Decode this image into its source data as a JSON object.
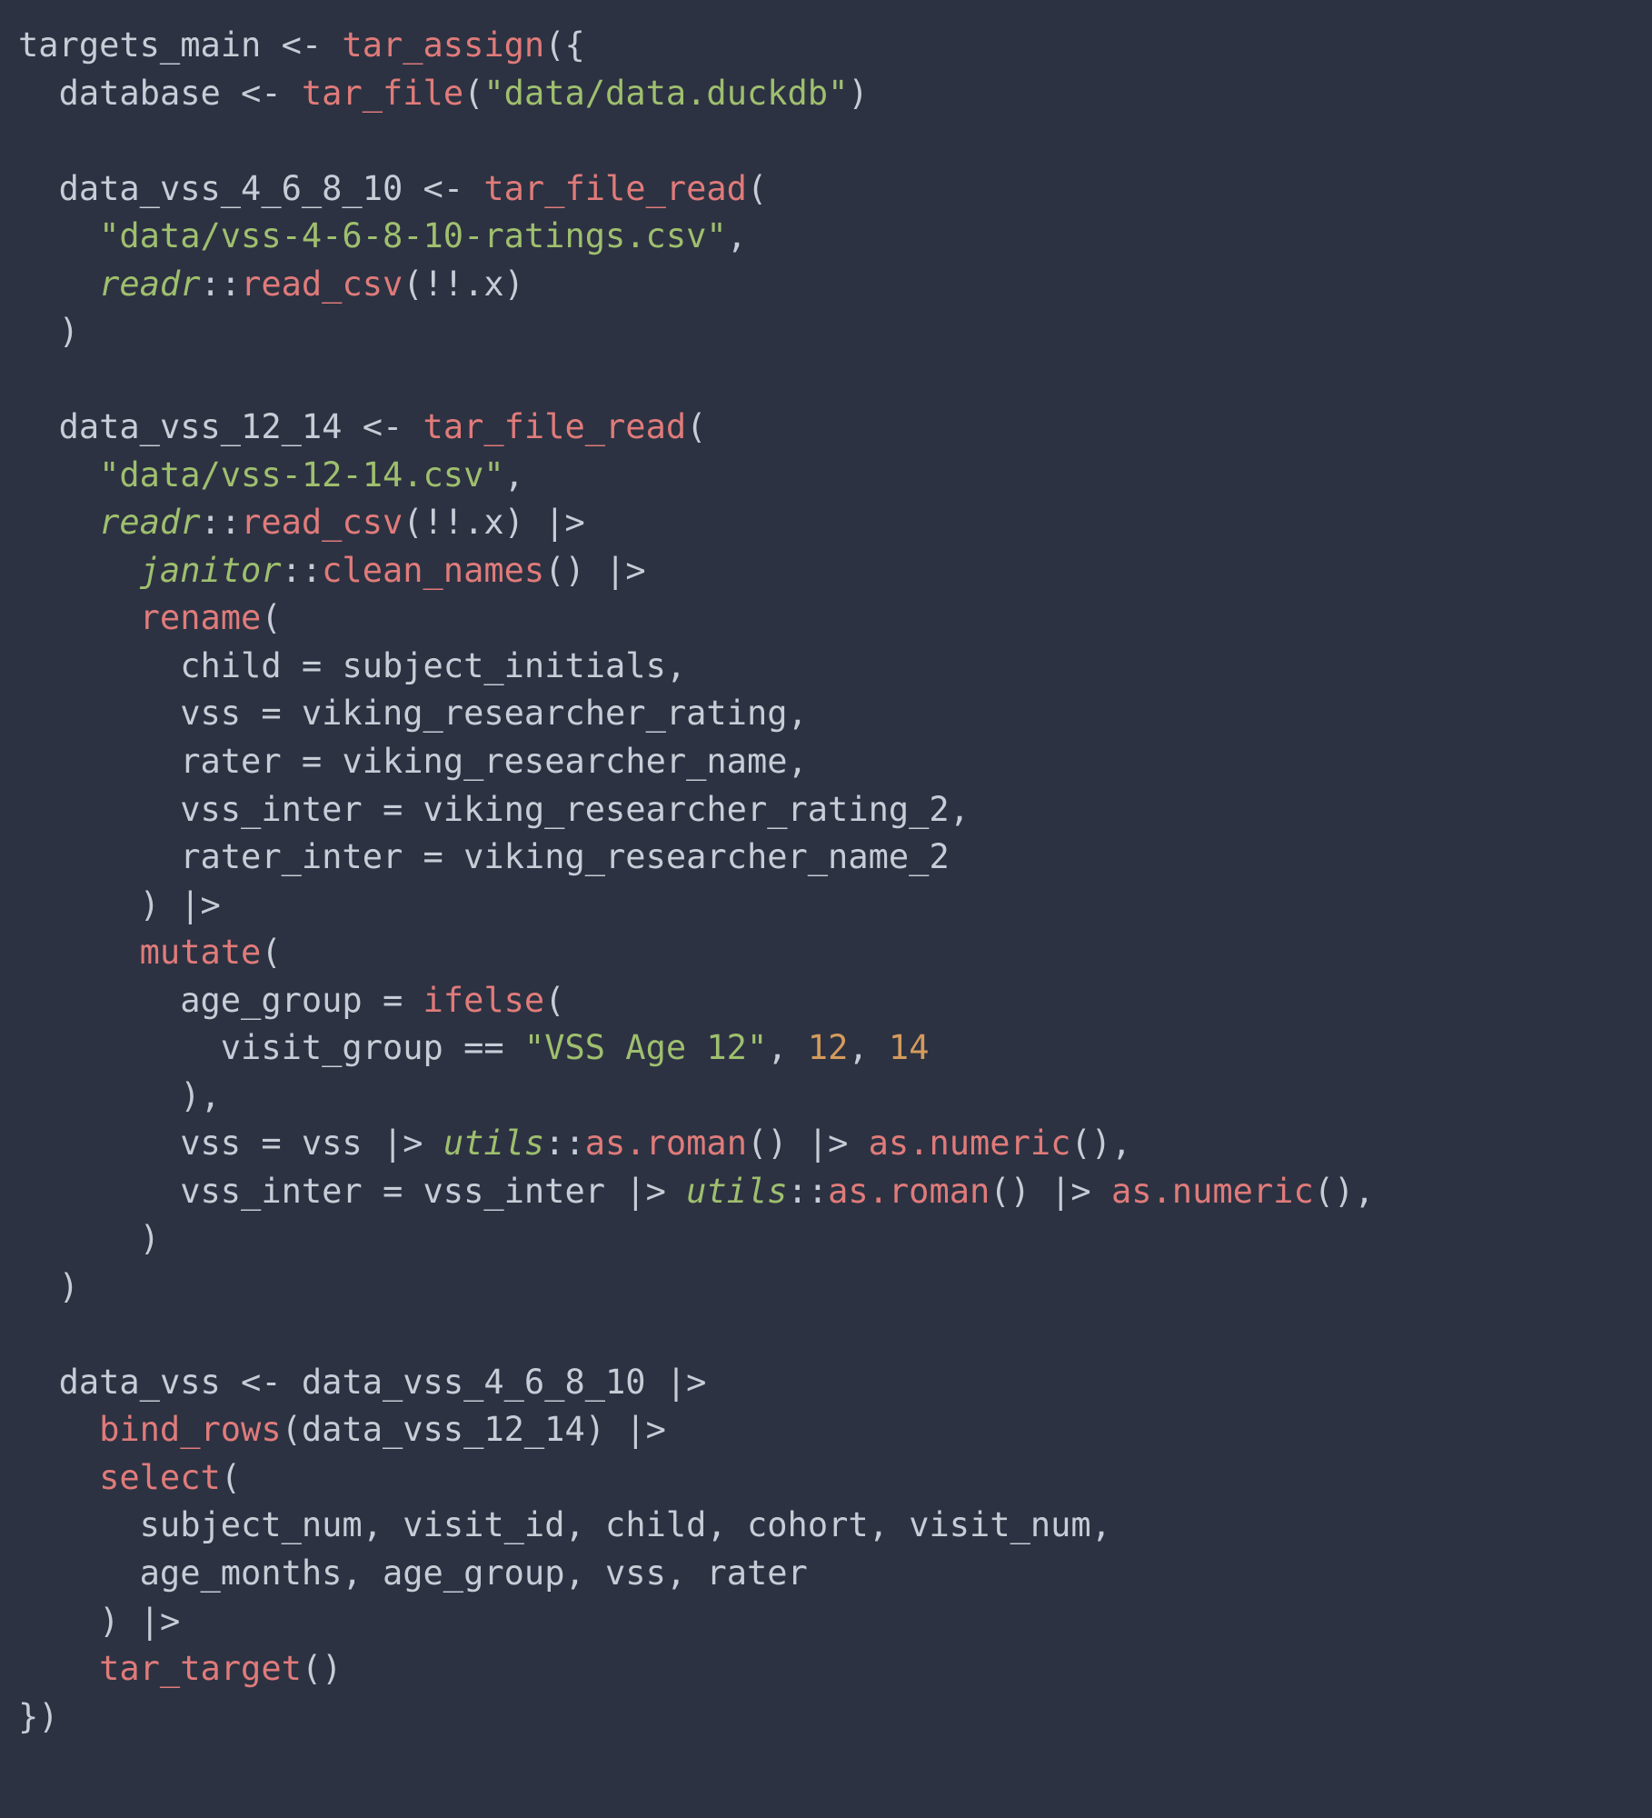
{
  "code": {
    "tokens": [
      [
        [
          "id",
          "targets_main"
        ],
        [
          "op",
          " <- "
        ],
        [
          "fn",
          "tar_assign"
        ],
        [
          "br",
          "({"
        ]
      ],
      [
        [
          "op",
          "  "
        ],
        [
          "id",
          "database"
        ],
        [
          "op",
          " <- "
        ],
        [
          "fn",
          "tar_file"
        ],
        [
          "br",
          "("
        ],
        [
          "str",
          "\"data/data.duckdb\""
        ],
        [
          "br",
          ")"
        ]
      ],
      [
        [
          "op",
          ""
        ]
      ],
      [
        [
          "op",
          "  "
        ],
        [
          "id",
          "data_vss_4_6_8_10"
        ],
        [
          "op",
          " <- "
        ],
        [
          "fn",
          "tar_file_read"
        ],
        [
          "br",
          "("
        ]
      ],
      [
        [
          "op",
          "    "
        ],
        [
          "str",
          "\"data/vss-4-6-8-10-ratings.csv\""
        ],
        [
          "op",
          ","
        ]
      ],
      [
        [
          "op",
          "    "
        ],
        [
          "pkg",
          "readr"
        ],
        [
          "op",
          "::"
        ],
        [
          "fn",
          "read_csv"
        ],
        [
          "br",
          "("
        ],
        [
          "op",
          "!!.x"
        ],
        [
          "br",
          ")"
        ]
      ],
      [
        [
          "op",
          "  "
        ],
        [
          "br",
          ")"
        ]
      ],
      [
        [
          "op",
          ""
        ]
      ],
      [
        [
          "op",
          "  "
        ],
        [
          "id",
          "data_vss_12_14"
        ],
        [
          "op",
          " <- "
        ],
        [
          "fn",
          "tar_file_read"
        ],
        [
          "br",
          "("
        ]
      ],
      [
        [
          "op",
          "    "
        ],
        [
          "str",
          "\"data/vss-12-14.csv\""
        ],
        [
          "op",
          ","
        ]
      ],
      [
        [
          "op",
          "    "
        ],
        [
          "pkg",
          "readr"
        ],
        [
          "op",
          "::"
        ],
        [
          "fn",
          "read_csv"
        ],
        [
          "br",
          "("
        ],
        [
          "op",
          "!!.x"
        ],
        [
          "br",
          ")"
        ],
        [
          "op",
          " |>"
        ]
      ],
      [
        [
          "op",
          "      "
        ],
        [
          "pkg",
          "janitor"
        ],
        [
          "op",
          "::"
        ],
        [
          "fn",
          "clean_names"
        ],
        [
          "br",
          "()"
        ],
        [
          "op",
          " |>"
        ]
      ],
      [
        [
          "op",
          "      "
        ],
        [
          "fn",
          "rename"
        ],
        [
          "br",
          "("
        ]
      ],
      [
        [
          "op",
          "        "
        ],
        [
          "id",
          "child"
        ],
        [
          "op",
          " = "
        ],
        [
          "id",
          "subject_initials"
        ],
        [
          "op",
          ","
        ]
      ],
      [
        [
          "op",
          "        "
        ],
        [
          "id",
          "vss"
        ],
        [
          "op",
          " = "
        ],
        [
          "id",
          "viking_researcher_rating"
        ],
        [
          "op",
          ","
        ]
      ],
      [
        [
          "op",
          "        "
        ],
        [
          "id",
          "rater"
        ],
        [
          "op",
          " = "
        ],
        [
          "id",
          "viking_researcher_name"
        ],
        [
          "op",
          ","
        ]
      ],
      [
        [
          "op",
          "        "
        ],
        [
          "id",
          "vss_inter"
        ],
        [
          "op",
          " = "
        ],
        [
          "id",
          "viking_researcher_rating_2"
        ],
        [
          "op",
          ","
        ]
      ],
      [
        [
          "op",
          "        "
        ],
        [
          "id",
          "rater_inter"
        ],
        [
          "op",
          " = "
        ],
        [
          "id",
          "viking_researcher_name_2"
        ]
      ],
      [
        [
          "op",
          "      "
        ],
        [
          "br",
          ")"
        ],
        [
          "op",
          " |>"
        ]
      ],
      [
        [
          "op",
          "      "
        ],
        [
          "fn",
          "mutate"
        ],
        [
          "br",
          "("
        ]
      ],
      [
        [
          "op",
          "        "
        ],
        [
          "id",
          "age_group"
        ],
        [
          "op",
          " = "
        ],
        [
          "fn",
          "ifelse"
        ],
        [
          "br",
          "("
        ]
      ],
      [
        [
          "op",
          "          "
        ],
        [
          "id",
          "visit_group"
        ],
        [
          "op",
          " == "
        ],
        [
          "str",
          "\"VSS Age 12\""
        ],
        [
          "op",
          ", "
        ],
        [
          "num",
          "12"
        ],
        [
          "op",
          ", "
        ],
        [
          "num",
          "14"
        ]
      ],
      [
        [
          "op",
          "        "
        ],
        [
          "br",
          ")"
        ],
        [
          "op",
          ","
        ]
      ],
      [
        [
          "op",
          "        "
        ],
        [
          "id",
          "vss"
        ],
        [
          "op",
          " = "
        ],
        [
          "id",
          "vss"
        ],
        [
          "op",
          " |> "
        ],
        [
          "pkg",
          "utils"
        ],
        [
          "op",
          "::"
        ],
        [
          "fn",
          "as.roman"
        ],
        [
          "br",
          "()"
        ],
        [
          "op",
          " |> "
        ],
        [
          "fn",
          "as.numeric"
        ],
        [
          "br",
          "()"
        ],
        [
          "op",
          ","
        ]
      ],
      [
        [
          "op",
          "        "
        ],
        [
          "id",
          "vss_inter"
        ],
        [
          "op",
          " = "
        ],
        [
          "id",
          "vss_inter"
        ],
        [
          "op",
          " |> "
        ],
        [
          "pkg",
          "utils"
        ],
        [
          "op",
          "::"
        ],
        [
          "fn",
          "as.roman"
        ],
        [
          "br",
          "()"
        ],
        [
          "op",
          " |> "
        ],
        [
          "fn",
          "as.numeric"
        ],
        [
          "br",
          "()"
        ],
        [
          "op",
          ","
        ]
      ],
      [
        [
          "op",
          "      "
        ],
        [
          "br",
          ")"
        ]
      ],
      [
        [
          "op",
          "  "
        ],
        [
          "br",
          ")"
        ]
      ],
      [
        [
          "op",
          ""
        ]
      ],
      [
        [
          "op",
          "  "
        ],
        [
          "id",
          "data_vss"
        ],
        [
          "op",
          " <- "
        ],
        [
          "id",
          "data_vss_4_6_8_10"
        ],
        [
          "op",
          " |>"
        ]
      ],
      [
        [
          "op",
          "    "
        ],
        [
          "fn",
          "bind_rows"
        ],
        [
          "br",
          "("
        ],
        [
          "id",
          "data_vss_12_14"
        ],
        [
          "br",
          ")"
        ],
        [
          "op",
          " |>"
        ]
      ],
      [
        [
          "op",
          "    "
        ],
        [
          "fn",
          "select"
        ],
        [
          "br",
          "("
        ]
      ],
      [
        [
          "op",
          "      "
        ],
        [
          "id",
          "subject_num"
        ],
        [
          "op",
          ", "
        ],
        [
          "id",
          "visit_id"
        ],
        [
          "op",
          ", "
        ],
        [
          "id",
          "child"
        ],
        [
          "op",
          ", "
        ],
        [
          "id",
          "cohort"
        ],
        [
          "op",
          ", "
        ],
        [
          "id",
          "visit_num"
        ],
        [
          "op",
          ","
        ]
      ],
      [
        [
          "op",
          "      "
        ],
        [
          "id",
          "age_months"
        ],
        [
          "op",
          ", "
        ],
        [
          "id",
          "age_group"
        ],
        [
          "op",
          ", "
        ],
        [
          "id",
          "vss"
        ],
        [
          "op",
          ", "
        ],
        [
          "id",
          "rater"
        ]
      ],
      [
        [
          "op",
          "    "
        ],
        [
          "br",
          ")"
        ],
        [
          "op",
          " |>"
        ]
      ],
      [
        [
          "op",
          "    "
        ],
        [
          "fn",
          "tar_target"
        ],
        [
          "br",
          "()"
        ]
      ],
      [
        [
          "br",
          "})"
        ]
      ]
    ]
  }
}
